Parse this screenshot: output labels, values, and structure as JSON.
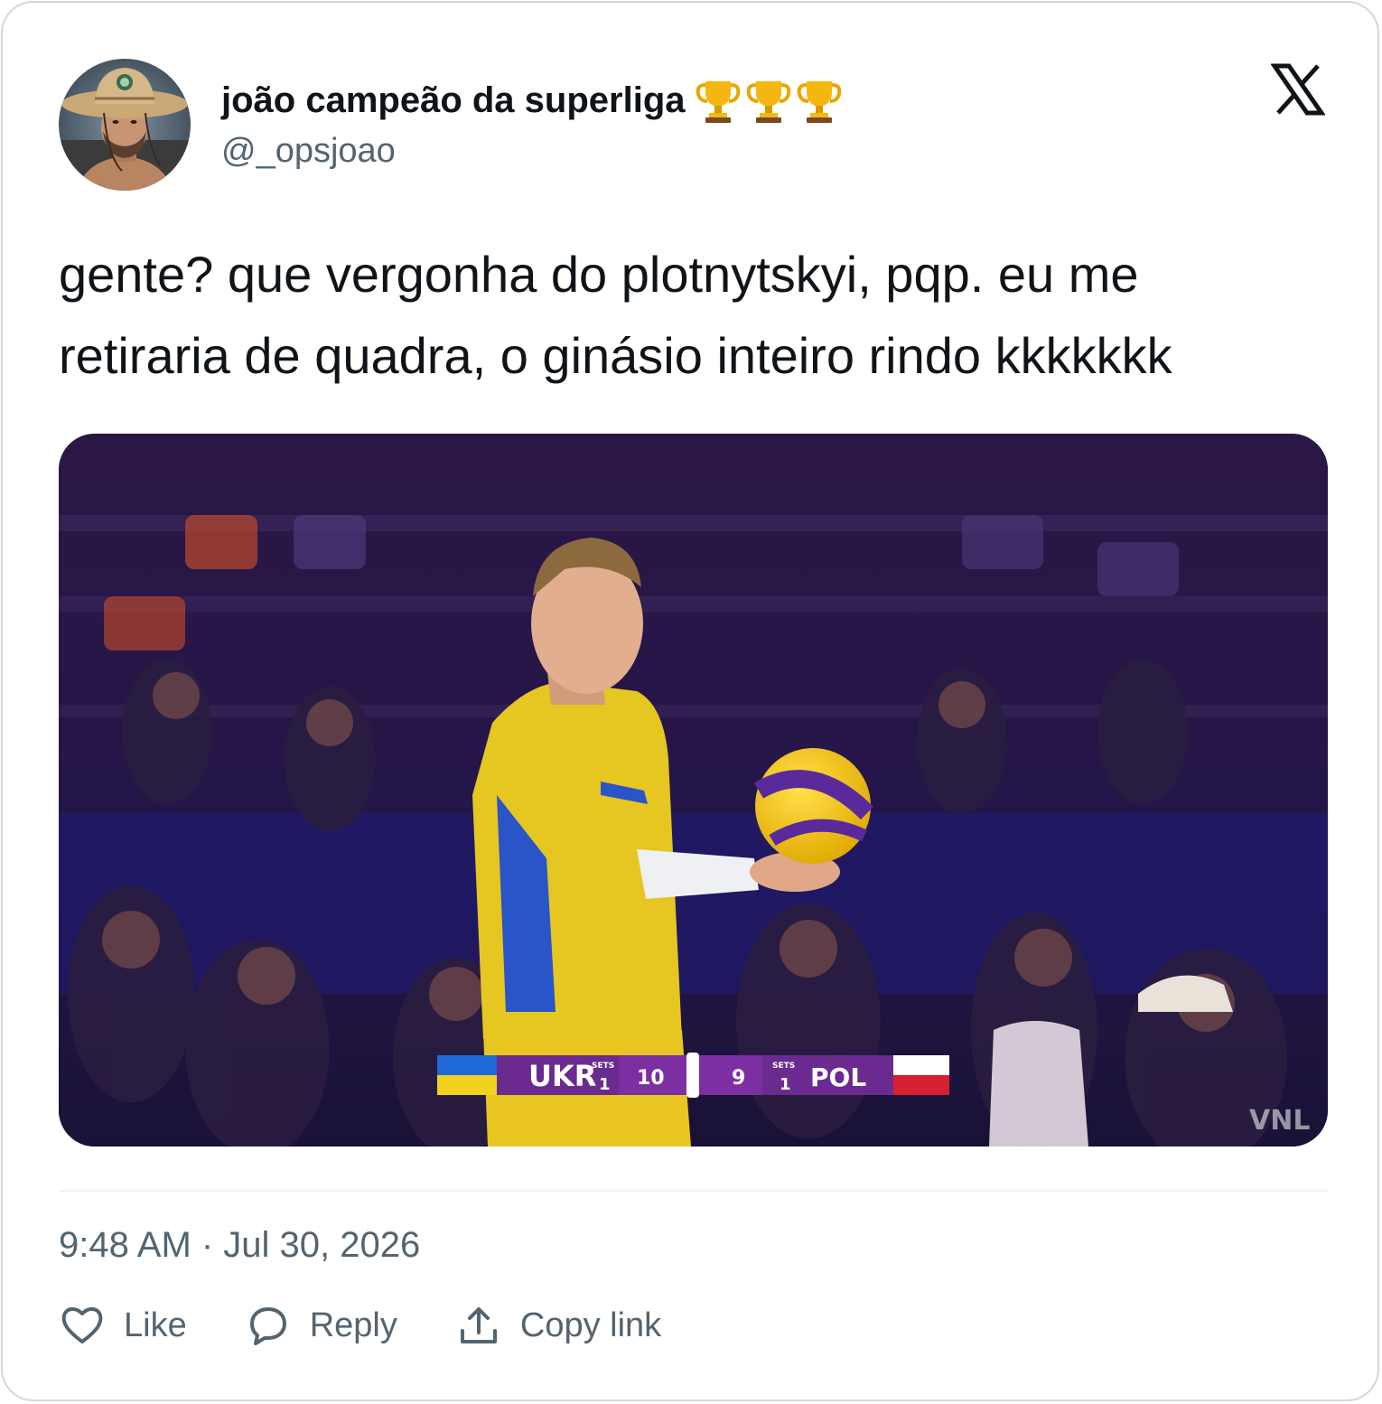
{
  "tweet": {
    "author": {
      "display_name": "joão campeão da superliga",
      "handle": "@_opsjoao",
      "badges": [
        "trophy",
        "trophy",
        "trophy"
      ]
    },
    "text": "gente? que vergonha do plotnytskyi, pqp. eu me retiraria de quadra, o ginásio inteiro rindo kkkkkkk",
    "timestamp": "9:48 AM · Jul 30, 2026",
    "brand_icon": "x-logo-icon",
    "media": {
      "description_icon": "volleyball-photo",
      "scoreboard": {
        "home_team": "UKR",
        "home_sets_label": "SETS",
        "home_sets": "1",
        "home_points": "10",
        "away_points": "9",
        "away_sets_label": "SETS",
        "away_sets": "1",
        "away_team": "POL",
        "watermark": "VNL"
      }
    }
  },
  "actions": {
    "like_label": "Like",
    "reply_label": "Reply",
    "copy_link_label": "Copy link"
  },
  "colors": {
    "text_primary": "#0f1419",
    "text_secondary": "#536471",
    "border": "#cfd9de"
  }
}
